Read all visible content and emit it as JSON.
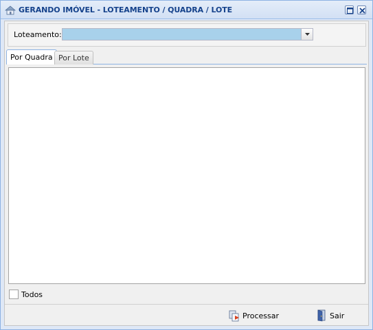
{
  "window": {
    "title": "GERANDO IMÓVEL - LOTEAMENTO / QUADRA / LOTE",
    "icons": {
      "app": "house-icon",
      "maximize": "maximize-icon",
      "close": "close-icon"
    }
  },
  "filter": {
    "loteamento_label": "Loteamento:",
    "loteamento_value": ""
  },
  "tabs": [
    {
      "label": "Por Quadra",
      "active": true
    },
    {
      "label": "Por Lote",
      "active": false
    }
  ],
  "todos": {
    "label": "Todos",
    "checked": false
  },
  "footer": {
    "processar_label": "Processar",
    "sair_label": "Sair",
    "icons": {
      "processar": "process-icon",
      "sair": "exit-door-icon"
    }
  },
  "colors": {
    "title_text": "#15428b",
    "window_border": "#8db2e3",
    "combo_bg": "#a8d1eb"
  }
}
